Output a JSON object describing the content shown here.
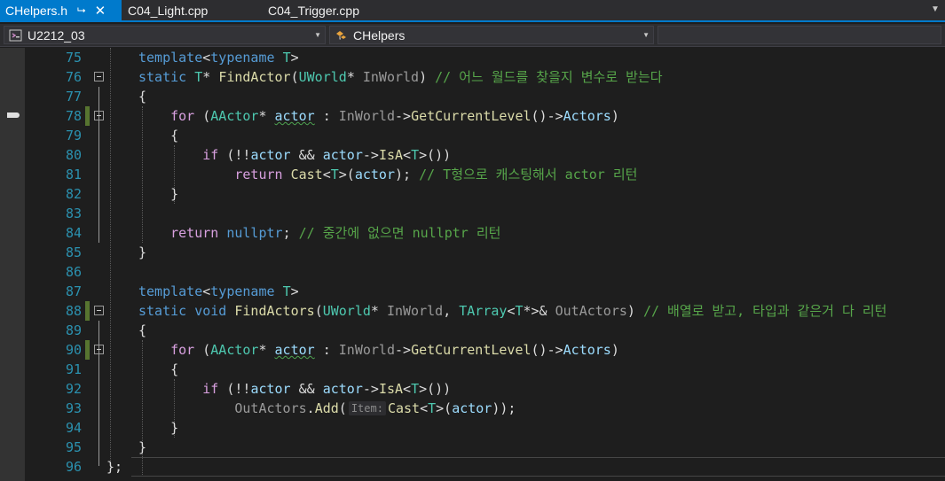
{
  "tabs": [
    {
      "label": "CHelpers.h",
      "active": true
    },
    {
      "label": "C04_Light.cpp",
      "active": false
    },
    {
      "label": "C04_Trigger.cpp",
      "active": false
    }
  ],
  "nav": {
    "project": "U2212_03",
    "scope": "CHelpers",
    "member": ""
  },
  "editor": {
    "lines": [
      {
        "n": "75"
      },
      {
        "n": "76"
      },
      {
        "n": "77"
      },
      {
        "n": "78"
      },
      {
        "n": "79"
      },
      {
        "n": "80"
      },
      {
        "n": "81"
      },
      {
        "n": "82"
      },
      {
        "n": "83"
      },
      {
        "n": "84"
      },
      {
        "n": "85"
      },
      {
        "n": "86"
      },
      {
        "n": "87"
      },
      {
        "n": "88"
      },
      {
        "n": "89"
      },
      {
        "n": "90"
      },
      {
        "n": "91"
      },
      {
        "n": "92"
      },
      {
        "n": "93"
      },
      {
        "n": "94"
      },
      {
        "n": "95"
      },
      {
        "n": "96"
      }
    ],
    "comments": {
      "l76": "// 어느 월드를 찾을지 변수로 받는다",
      "l81": "// T형으로 캐스팅해서 actor 리턴",
      "l84": "// 중간에 없으면 nullptr 리턴",
      "l88": "// 배열로 받고, 타입과 같은거 다 리턴"
    },
    "param_hint": "Item:",
    "colors": {
      "keyword": "#569cd6",
      "type": "#4ec9b0",
      "function": "#dcdcaa",
      "parameter": "#9a9a9a",
      "local": "#9cdcfe",
      "comment": "#57a64a",
      "control": "#d8a0df",
      "line_number": "#2b91af",
      "change_bar": "#577430",
      "tab_active": "#007acc"
    }
  }
}
